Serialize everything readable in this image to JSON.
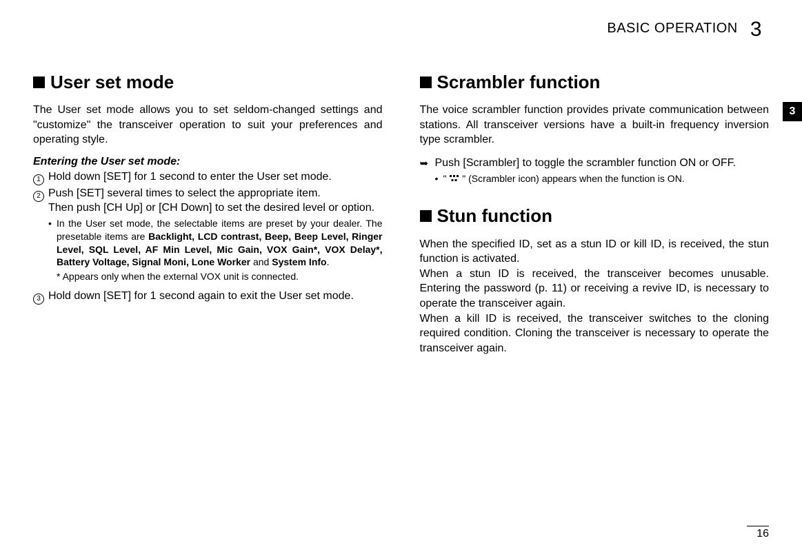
{
  "header": {
    "title": "BASIC OPERATION",
    "chapter": "3"
  },
  "tab": "3",
  "left": {
    "h": "User set mode",
    "intro": "The User set mode allows you to set seldom-changed set­tings and \"customize\" the transceiver operation to suit your preferences and operating style.",
    "subhead": "Entering the User set mode:",
    "step1": "Hold down [SET] for 1 second to enter the User set mode.",
    "step2a": "Push [SET] several times to select the appropriate item.",
    "step2b": "Then push [CH Up] or [CH Down] to set the desired level or option.",
    "note1a": "In the User set mode, the selectable items are preset by your dealer. The presetable items are ",
    "bold_items": "Backlight, LCD contrast, Beep, Beep Level, Ringer Level, SQL Level, AF Min Level, Mic Gain, VOX Gain*, VOX Delay*, Battery Voltage, Signal Moni, Lone Worker",
    "bold_and": " and ",
    "bold_last": "System Info",
    "note1b": ".",
    "note2": "* Appears only when the external VOX unit is connected.",
    "step3": "Hold down [SET] for 1 second again to exit the User set mode."
  },
  "right": {
    "h1": "Scrambler function",
    "p1": "The voice scrambler function provides private communica­tion between stations. All transceiver versions have a built-in frequency inversion type scrambler.",
    "step1": "Push [Scrambler] to toggle the scrambler function ON or OFF.",
    "note1a": "\" ",
    "note1b": " \" (Scrambler icon) appears when the function is ON.",
    "h2": "Stun function",
    "p2": "When the specified ID, set as a stun ID or kill ID, is received, the stun function is activated.",
    "p3": "When a stun ID is received, the transceiver becomes unus­able. Entering the password (p. 11) or receiving a revive ID, is necessary to operate the transceiver again.",
    "p4": "When a kill ID is received, the transceiver switches to the cloning required condition. Cloning the transceiver is neces­sary to operate the transceiver again."
  },
  "page_number": "16"
}
